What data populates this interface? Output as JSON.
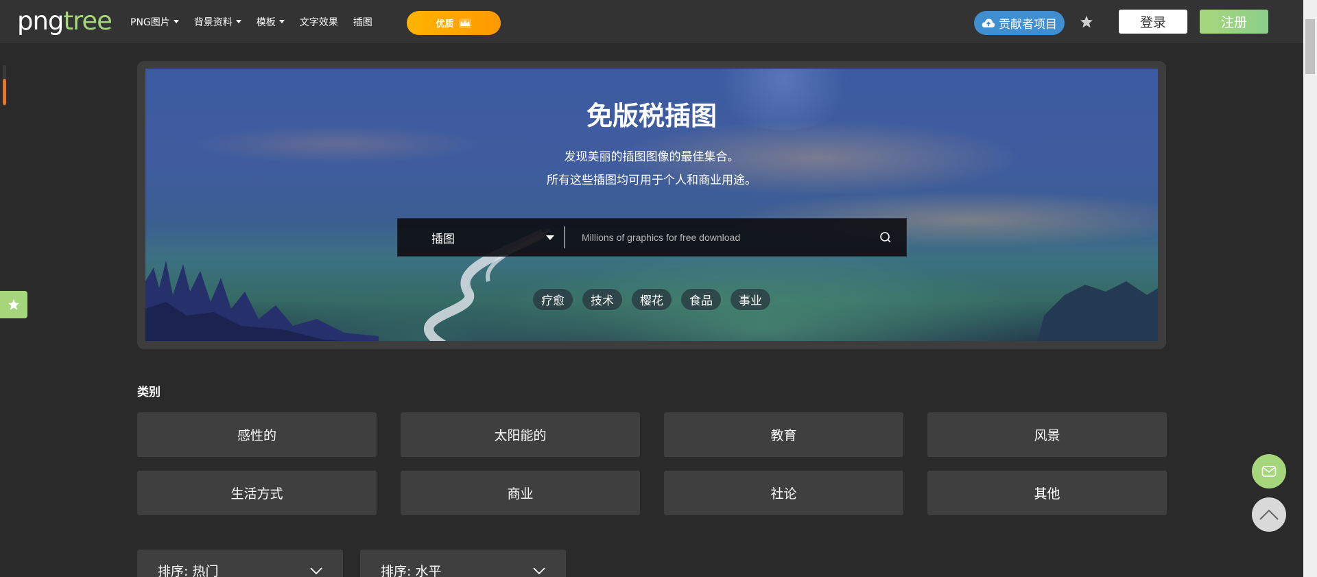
{
  "header": {
    "logo_png": "png",
    "logo_tree": "tree",
    "nav": [
      {
        "label": "PNG图片",
        "has_caret": true
      },
      {
        "label": "背景资料",
        "has_caret": true
      },
      {
        "label": "模板",
        "has_caret": true
      },
      {
        "label": "文字效果",
        "has_caret": false
      },
      {
        "label": "插图",
        "has_caret": false
      }
    ],
    "premium_label": "优质",
    "contributor_label": "贡献者项目",
    "login_label": "登录",
    "register_label": "注册"
  },
  "hero": {
    "title": "免版税插图",
    "subtitle_line1": "发现美丽的插图图像的最佳集合。",
    "subtitle_line2": "所有这些插图均可用于个人和商业用途。",
    "search": {
      "category": "插图",
      "placeholder": "Millions of graphics for free download"
    },
    "tags": [
      "疗愈",
      "技术",
      "樱花",
      "食品",
      "事业"
    ]
  },
  "categories": {
    "label": "类别",
    "items": [
      "感性的",
      "太阳能的",
      "教育",
      "风景",
      "生活方式",
      "商业",
      "社论",
      "其他"
    ]
  },
  "sort": {
    "sort1": "排序: 热门",
    "sort2": "排序: 水平"
  },
  "colors": {
    "accent_green": "#a6d67c",
    "premium_orange": "#ffb400",
    "contrib_blue": "#3e8ed0",
    "background": "#2a2a2a"
  }
}
